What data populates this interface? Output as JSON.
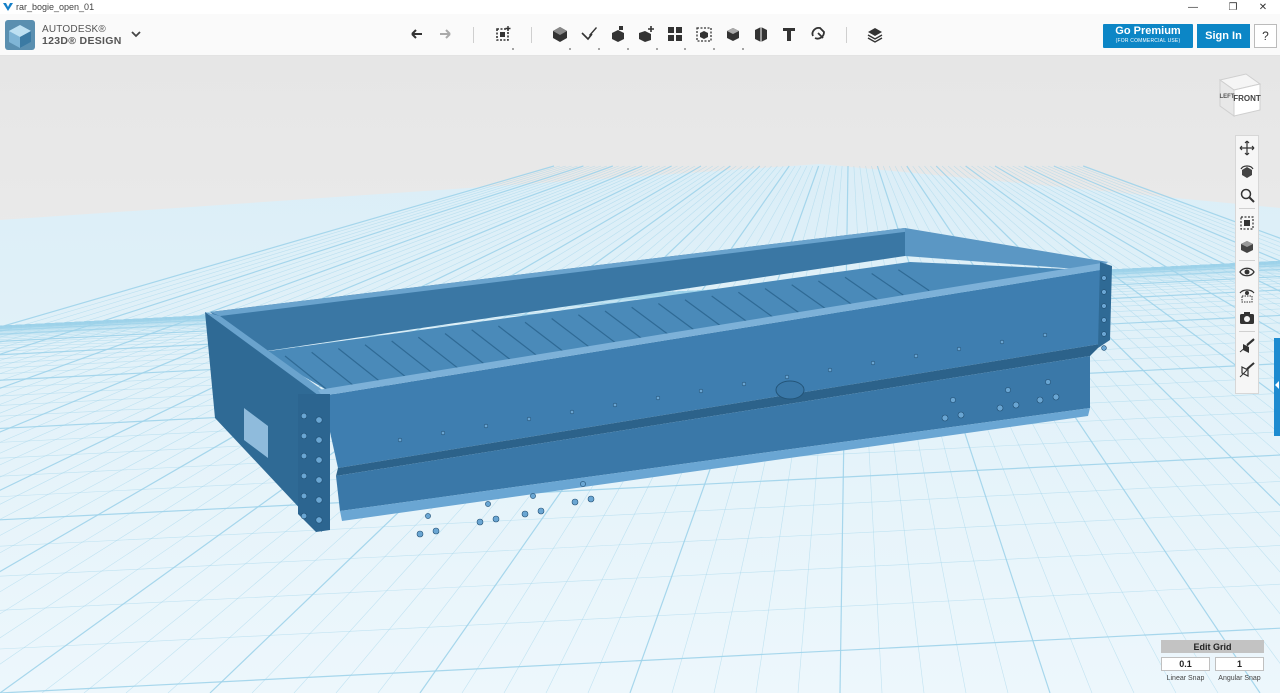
{
  "window": {
    "title": "rar_bogie_open_01",
    "app_icon": "autodesk-v-icon",
    "controls": [
      {
        "name": "minimize-button",
        "glyph": "—"
      },
      {
        "name": "maximize-button",
        "glyph": "❐"
      },
      {
        "name": "close-button",
        "glyph": "✕"
      }
    ]
  },
  "brand": {
    "line1": "AUTODESK®",
    "line2": "123D® DESIGN",
    "menu_icon": "chevron-down-icon"
  },
  "toolbar": {
    "undo_icon": "undo-icon",
    "redo_icon": "redo-icon",
    "tools": [
      "transform-icon",
      "primitives-icon",
      "sketch-icon",
      "construct-icon",
      "modify-icon",
      "pattern-icon",
      "grouping-icon",
      "combine-icon",
      "measure-icon",
      "text-icon",
      "snap-icon",
      "material-icon"
    ]
  },
  "account": {
    "premium_label": "Go Premium",
    "premium_sub": "(FOR COMMERCIAL USE)",
    "signin_label": "Sign In",
    "help_label": "?"
  },
  "viewcube": {
    "front_label": "FRONT",
    "left_label": "LEFT"
  },
  "navigation": [
    "pan-icon",
    "orbit-icon",
    "zoom-icon",
    "fit-icon",
    "view-icon",
    "visibility-icon",
    "hidden-icon",
    "screenshot-icon",
    "material-toggle-icon",
    "outline-toggle-icon"
  ],
  "grid": {
    "edit_label": "Edit Grid",
    "linear_snap_value": "0.1",
    "angular_snap_value": "1",
    "linear_snap_label": "Linear Snap",
    "angular_snap_label": "Angular Snap"
  },
  "colors": {
    "model": "#3f7fae",
    "model_dark": "#2e6890",
    "model_light": "#5a95c3",
    "grid_line": "#9fd3ea",
    "floor": "#e9f5fb",
    "background": "#ececec",
    "accent": "#0c86c6"
  }
}
